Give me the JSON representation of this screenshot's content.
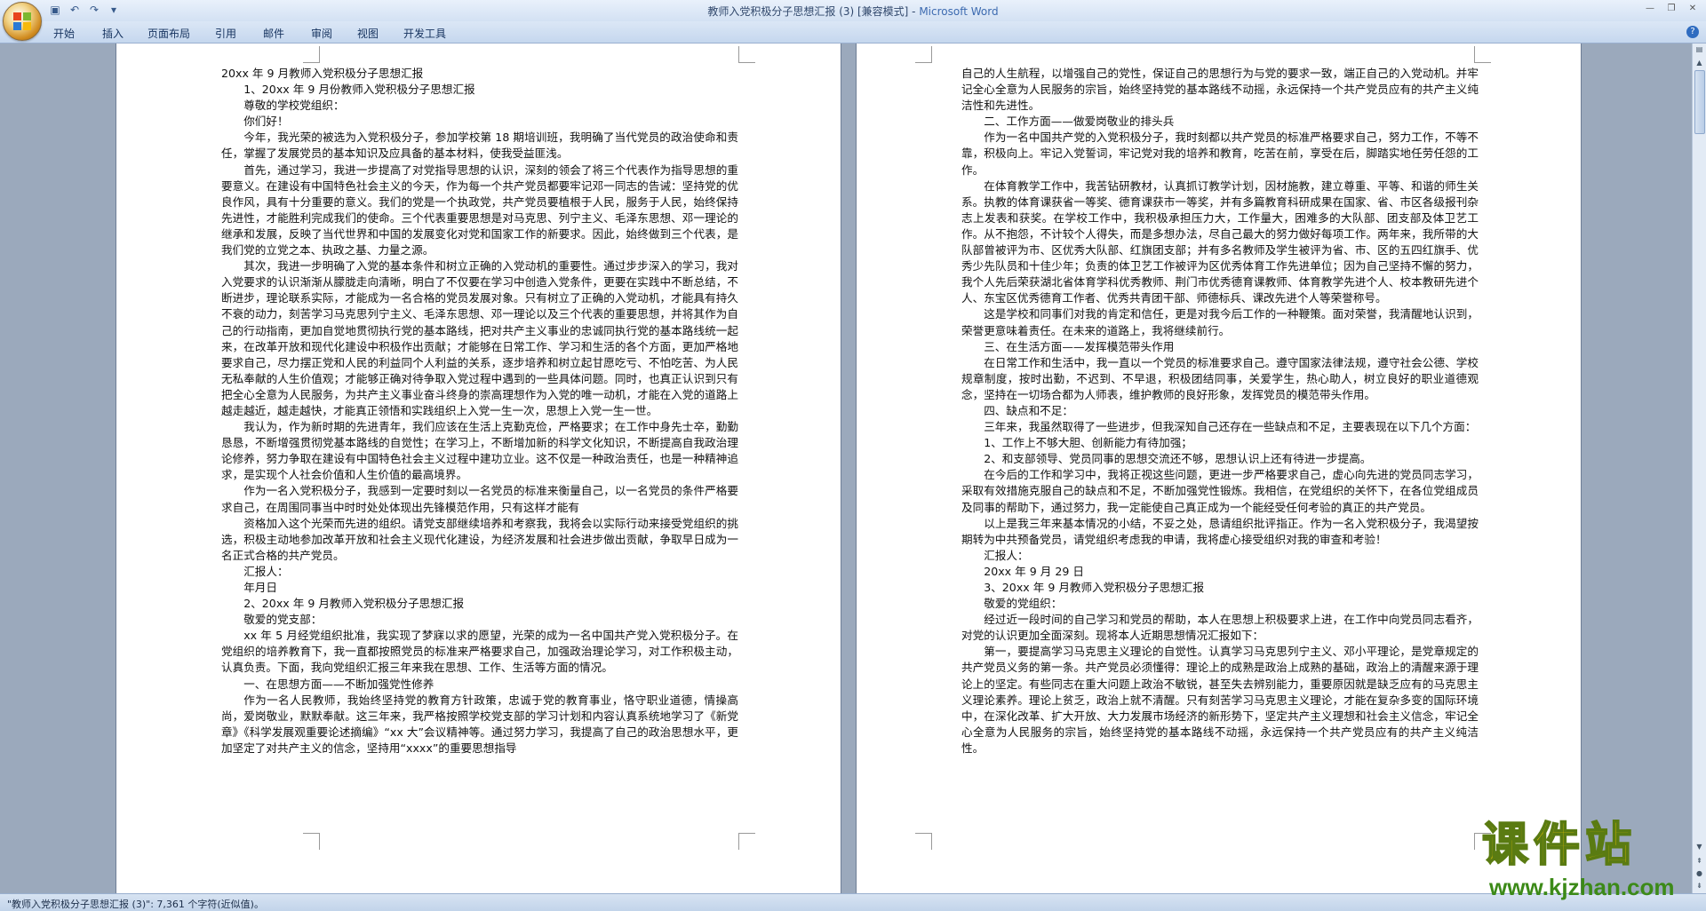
{
  "window": {
    "title_doc": "教师入党积极分子思想汇报 (3) [兼容模式] - ",
    "title_app": "Microsoft Word"
  },
  "quick_access": {
    "icons": [
      "save-icon",
      "undo-icon",
      "redo-icon",
      "customize-icon"
    ]
  },
  "ribbon": {
    "tabs": [
      "开始",
      "插入",
      "页面布局",
      "引用",
      "邮件",
      "审阅",
      "视图",
      "开发工具"
    ]
  },
  "left_page": {
    "paragraphs": [
      {
        "t": "20xx 年 9 月教师入党积极分子思想汇报",
        "ind": false
      },
      {
        "t": "1、20xx 年 9 月份教师入党积极分子思想汇报",
        "ind": true
      },
      {
        "t": "尊敬的学校党组织：",
        "ind": true
      },
      {
        "t": "你们好！",
        "ind": true
      },
      {
        "t": "今年，我光荣的被选为入党积极分子，参加学校第 18 期培训班，我明确了当代党员的政治使命和责任，掌握了发展党员的基本知识及应具备的基本材料，使我受益匪浅。",
        "ind": true
      },
      {
        "t": "首先，通过学习，我进一步提高了对党指导思想的认识，深刻的领会了将三个代表作为指导思想的重要意义。在建设有中国特色社会主义的今天，作为每一个共产党员都要牢记邓一同志的告诫：坚持党的优良作风，具有十分重要的意义。我们的党是一个执政党，共产党员要植根于人民，服务于人民，始终保持先进性，才能胜利完成我们的使命。三个代表重要思想是对马克思、列宁主义、毛泽东思想、邓一理论的继承和发展，反映了当代世界和中国的发展变化对党和国家工作的新要求。因此，始终做到三个代表，是我们党的立党之本、执政之基、力量之源。",
        "ind": true
      },
      {
        "t": "其次，我进一步明确了入党的基本条件和树立正确的入党动机的重要性。通过步步深入的学习，我对入党要求的认识渐渐从朦胧走向清晰，明白了不仅要在学习中创造入党条件，更要在实践中不断总结，不断进步，理论联系实际，才能成为一名合格的党员发展对象。只有树立了正确的入党动机，才能具有持久不衰的动力，刻苦学习马克思列宁主义、毛泽东思想、邓一理论以及三个代表的重要思想，并将其作为自己的行动指南，更加自觉地贯彻执行党的基本路线，把对共产主义事业的忠诚同执行党的基本路线统一起来，在改革开放和现代化建设中积极作出贡献；才能够在日常工作、学习和生活的各个方面，更加严格地要求自己，尽力摆正党和人民的利益同个人利益的关系，逐步培养和树立起甘愿吃亏、不怕吃苦、为人民无私奉献的人生价值观；才能够正确对待争取入党过程中遇到的一些具体问题。同时，也真正认识到只有把全心全意为人民服务，为共产主义事业奋斗终身的崇高理想作为入党的唯一动机，才能在入党的道路上越走越近，越走越快，才能真正领悟和实践组织上入党一生一次，思想上入党一生一世。",
        "ind": true
      },
      {
        "t": "我认为，作为新时期的先进青年，我们应该在生活上克勤克俭，严格要求；在工作中身先士卒，勤勤恳恳，不断增强贯彻党基本路线的自觉性；在学习上，不断增加新的科学文化知识，不断提高自我政治理论修养，努力争取在建设有中国特色社会主义过程中建功立业。这不仅是一种政治责任，也是一种精神追求，是实现个人社会价值和人生价值的最高境界。",
        "ind": true
      },
      {
        "t": "作为一名入党积极分子，我感到一定要时刻以一名党员的标准来衡量自己，以一名党员的条件严格要求自己，在周围同事当中时时处处体现出先锋模范作用，只有这样才能有",
        "ind": true
      },
      {
        "t": "资格加入这个光荣而先进的组织。请党支部继续培养和考察我，我将会以实际行动来接受党组织的挑选，积极主动地参加改革开放和社会主义现代化建设，为经济发展和社会进步做出贡献，争取早日成为一名正式合格的共产党员。",
        "ind": true
      },
      {
        "t": "汇报人：",
        "ind": true
      },
      {
        "t": "年月日",
        "ind": true
      },
      {
        "t": "2、20xx 年 9 月教师入党积极分子思想汇报",
        "ind": true
      },
      {
        "t": "敬爱的党支部：",
        "ind": true
      },
      {
        "t": "xx 年 5 月经党组织批准，我实现了梦寐以求的愿望，光荣的成为一名中国共产党入党积极分子。在党组织的培养教育下，我一直都按照党员的标准来严格要求自己，加强政治理论学习，对工作积极主动，认真负责。下面，我向党组织汇报三年来我在思想、工作、生活等方面的情况。",
        "ind": true
      },
      {
        "t": "一、在思想方面——不断加强党性修养",
        "ind": true
      },
      {
        "t": "作为一名人民教师，我始终坚持党的教育方针政策，忠诚于党的教育事业，恪守职业道德，情操高尚，爱岗敬业，默默奉献。这三年来，我严格按照学校党支部的学习计划和内容认真系统地学习了《新党章》《科学发展观重要论述摘编》“xx 大”会议精神等。通过努力学习，我提高了自己的政治思想水平，更加坚定了对共产主义的信念，坚持用“xxxx”的重要思想指导",
        "ind": true
      }
    ]
  },
  "right_page": {
    "paragraphs": [
      {
        "t": "自己的人生航程，以增强自己的党性，保证自己的思想行为与党的要求一致，端正自己的入党动机。并牢记全心全意为人民服务的宗旨，始终坚持党的基本路线不动摇，永远保持一个共产党员应有的共产主义纯洁性和先进性。",
        "ind": false
      },
      {
        "t": "二、工作方面——做爱岗敬业的排头兵",
        "ind": true
      },
      {
        "t": "作为一名中国共产党的入党积极分子，我时刻都以共产党员的标准严格要求自己，努力工作，不等不靠，积极向上。牢记入党誓词，牢记党对我的培养和教育，吃苦在前，享受在后，脚踏实地任劳任怨的工作。",
        "ind": true
      },
      {
        "t": "在体育教学工作中，我苦钻研教材，认真抓订教学计划，因材施教，建立尊重、平等、和谐的师生关系。执教的体育课获省一等奖、德育课获市一等奖，并有多篇教育科研成果在国家、省、市区各级报刊杂志上发表和获奖。在学校工作中，我积极承担压力大，工作量大，困难多的大队部、团支部及体卫艺工作。从不抱怨，不计较个人得失，而是多想办法，尽自己最大的努力做好每项工作。两年来，我所带的大队部曾被评为市、区优秀大队部、红旗团支部；并有多名教师及学生被评为省、市、区的五四红旗手、优秀少先队员和十佳少年；负责的体卫艺工作被评为区优秀体育工作先进单位；因为自己坚持不懈的努力，我个人先后荣获湖北省体育学科优秀教师、荆门市优秀德育课教师、体育教学先进个人、校本教研先进个人、东宝区优秀德育工作者、优秀共青团干部、师德标兵、课改先进个人等荣誉称号。",
        "ind": true
      },
      {
        "t": "这是学校和同事们对我的肯定和信任，更是对我今后工作的一种鞭策。面对荣誉，我清醒地认识到，荣誉更意味着责任。在未来的道路上，我将继续前行。",
        "ind": true
      },
      {
        "t": "三、在生活方面——发挥模范带头作用",
        "ind": true
      },
      {
        "t": "在日常工作和生活中，我一直以一个党员的标准要求自己。遵守国家法律法规，遵守社会公德、学校规章制度，按时出勤，不迟到、不早退，积极团结同事，关爱学生，热心助人，树立良好的职业道德观念，坚持在一切场合都为人师表，维护教师的良好形象，发挥党员的模范带头作用。",
        "ind": true
      },
      {
        "t": "四、缺点和不足：",
        "ind": true
      },
      {
        "t": "三年来，我虽然取得了一些进步，但我深知自己还存在一些缺点和不足，主要表现在以下几个方面：",
        "ind": true
      },
      {
        "t": "1、工作上不够大胆、创新能力有待加强；",
        "ind": true
      },
      {
        "t": "2、和支部领导、党员同事的思想交流还不够，思想认识上还有待进一步提高。",
        "ind": true
      },
      {
        "t": "在今后的工作和学习中，我将正视这些问题，更进一步严格要求自己，虚心向先进的党员同志学习，采取有效措施克服自己的缺点和不足，不断加强党性锻炼。我相信，在党组织的关怀下，在各位党组成员及同事的帮助下，通过努力，我一定能使自己真正成为一个能经受任何考验的真正的共产党员。",
        "ind": true
      },
      {
        "t": "以上是我三年来基本情况的小结，不妥之处，恳请组织批评指正。作为一名入党积极分子，我渴望按期转为中共预备党员，请党组织考虑我的申请，我将虚心接受组织对我的审查和考验！",
        "ind": true
      },
      {
        "t": "汇报人：",
        "ind": true
      },
      {
        "t": "20xx 年 9 月 29 日",
        "ind": true
      },
      {
        "t": "3、20xx 年 9 月教师入党积极分子思想汇报",
        "ind": true
      },
      {
        "t": "敬爱的党组织：",
        "ind": true
      },
      {
        "t": "经过近一段时间的自己学习和党员的帮助，本人在思想上积极要求上进，在工作中向党员同志看齐，对党的认识更加全面深刻。现将本人近期思想情况汇报如下：",
        "ind": true
      },
      {
        "t": "第一，要提高学习马克思主义理论的自觉性。认真学习马克思列宁主义、邓小平理论，是党章规定的共产党员义务的第一条。共产党员必须懂得：理论上的成熟是政治上成熟的基础，政治上的清醒来源于理论上的坚定。有些同志在重大问题上政治不敏锐，甚至失去辨别能力，重要原因就是缺乏应有的马克思主义理论素养。理论上贫乏，政治上就不清醒。只有刻苦学习马克思主义理论，才能在复杂多变的国际环境中，在深化改革、扩大开放、大力发展市场经济的新形势下，坚定共产主义理想和社会主义信念，牢记全心全意为人民服务的宗旨，始终坚持党的基本路线不动摇，永远保持一个共产党员应有的共产主义纯洁性。",
        "ind": true
      }
    ]
  },
  "status_bar": {
    "text": "\"教师入党积极分子思想汇报 (3)\": 7,361 个字符(近似值)。"
  },
  "watermark": {
    "text_cn": "课件站",
    "url": "www.kjzhan.com"
  }
}
